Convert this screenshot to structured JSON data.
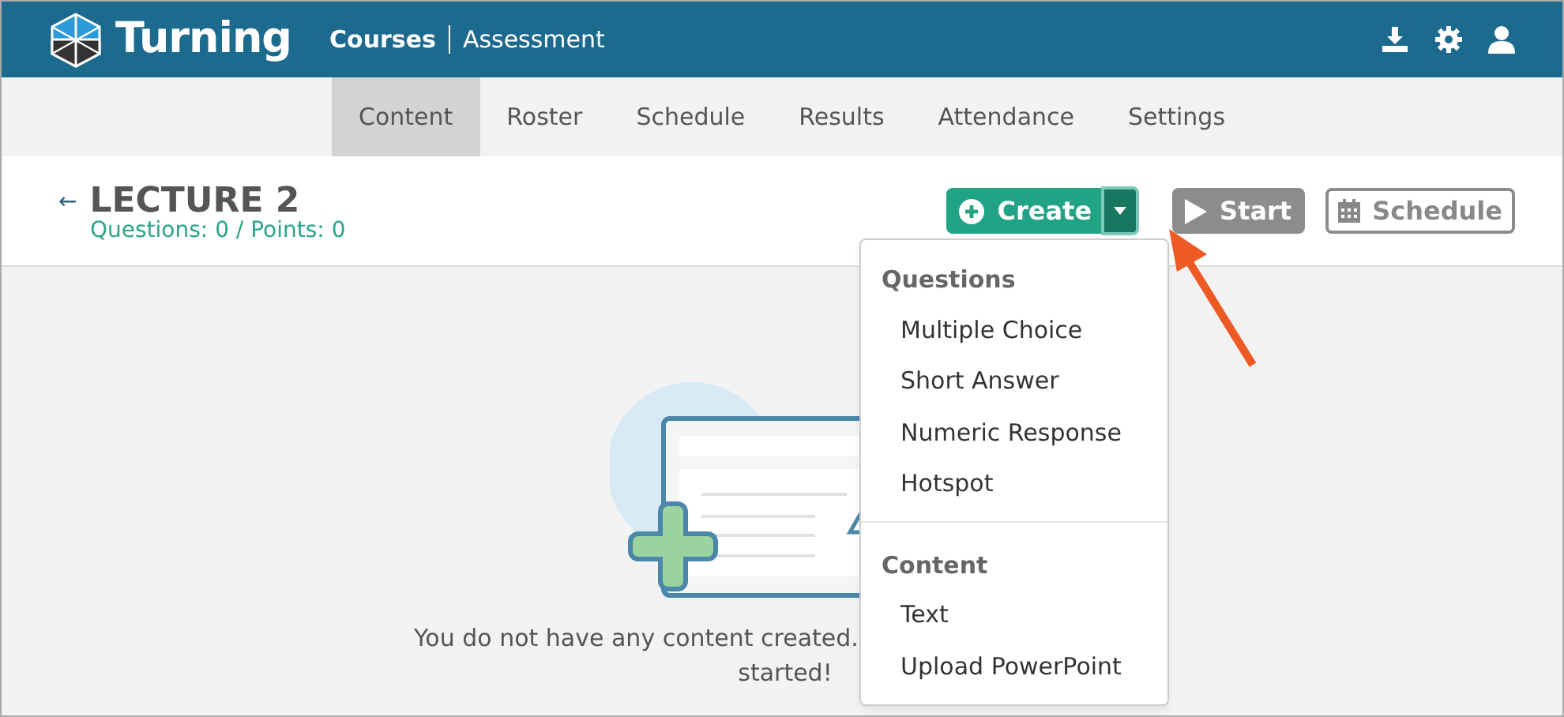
{
  "header": {
    "brand": "Turning",
    "breadcrumb": [
      "Courses",
      "Assessment"
    ]
  },
  "tabs": [
    {
      "label": "Content",
      "selected": true
    },
    {
      "label": "Roster",
      "selected": false
    },
    {
      "label": "Schedule",
      "selected": false
    },
    {
      "label": "Results",
      "selected": false
    },
    {
      "label": "Attendance",
      "selected": false
    },
    {
      "label": "Settings",
      "selected": false
    }
  ],
  "lecture": {
    "back": "←",
    "title": "LECTURE 2",
    "summary": "Questions: 0 / Points: 0"
  },
  "actions": {
    "create": "Create",
    "create_expanded": true,
    "start": "Start",
    "schedule": "Schedule"
  },
  "menu": [
    {
      "header": "Questions",
      "items": [
        "Multiple Choice",
        "Short Answer",
        "Numeric Response",
        "Hotspot"
      ]
    },
    {
      "header": "Content",
      "items": [
        "Text",
        "Upload PowerPoint"
      ]
    }
  ],
  "empty": {
    "lines": [
      "You do not have any content created.",
      "started!"
    ]
  }
}
